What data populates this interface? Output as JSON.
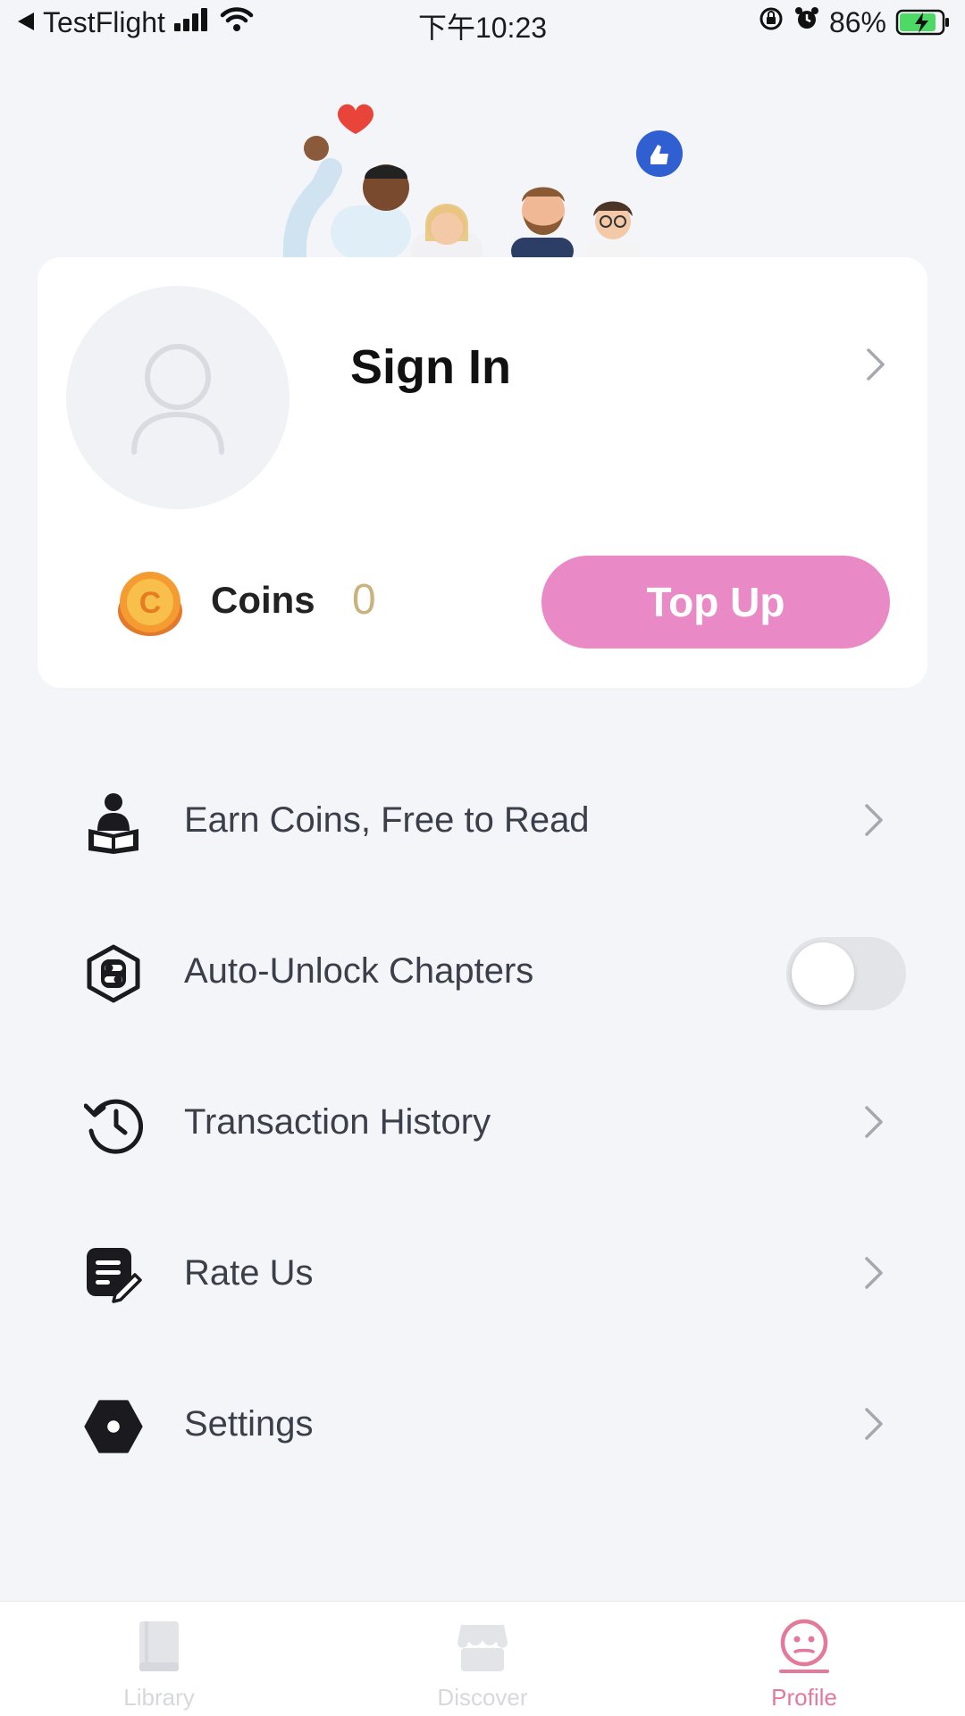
{
  "status_bar": {
    "back_app": "TestFlight",
    "time": "下午10:23",
    "battery": "86%"
  },
  "profile": {
    "sign_in": "Sign In",
    "coins_label": "Coins",
    "coins_value": "0",
    "top_up": "Top Up"
  },
  "menu": [
    {
      "label": "Earn Coins, Free to Read",
      "icon": "reader-icon"
    },
    {
      "label": "Auto-Unlock Chapters",
      "icon": "unlock-toggle-icon",
      "toggle_on": false
    },
    {
      "label": "Transaction History",
      "icon": "history-icon"
    },
    {
      "label": "Rate Us",
      "icon": "rate-note-icon"
    },
    {
      "label": "Settings",
      "icon": "settings-hex-icon"
    }
  ],
  "tabs": [
    {
      "label": "Library",
      "icon": "book-icon",
      "active": false
    },
    {
      "label": "Discover",
      "icon": "store-icon",
      "active": false
    },
    {
      "label": "Profile",
      "icon": "smiley-icon",
      "active": true
    }
  ],
  "colors": {
    "accent_pink": "#e98ac6",
    "tab_active": "#e47a9b",
    "coin_value": "#c9b27d"
  }
}
